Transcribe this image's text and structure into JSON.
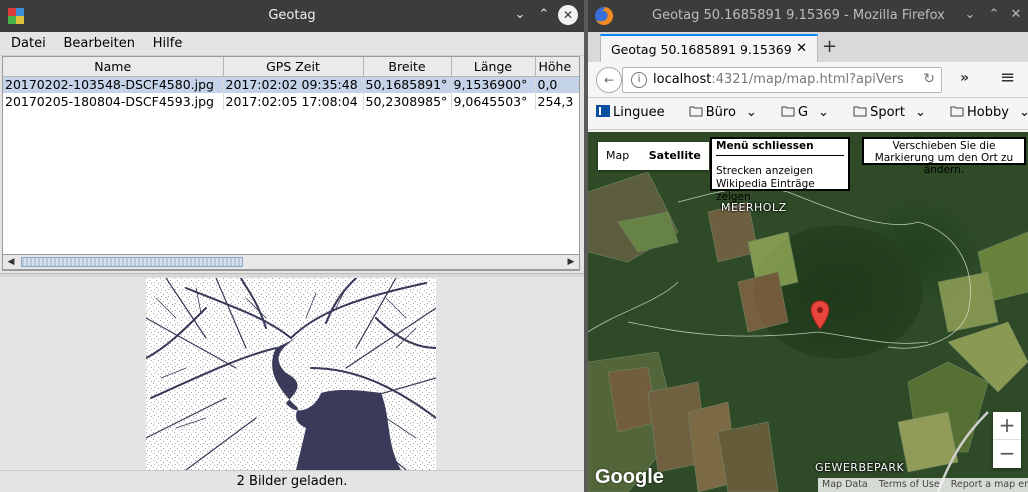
{
  "geotag": {
    "title": "Geotag",
    "menu": [
      "Datei",
      "Bearbeiten",
      "Hilfe"
    ],
    "columns": [
      "Name",
      "GPS Zeit",
      "Breite",
      "Länge",
      "Höhe"
    ],
    "rows": [
      [
        "20170202-103548-DSCF4580.jpg",
        "2017:02:02 09:35:48",
        "50,1685891°",
        "9,1536900°",
        "0,0"
      ],
      [
        "20170205-180804-DSCF4593.jpg",
        "2017:02:05 17:08:04",
        "50,2308985°",
        "9,0645503°",
        "254,3"
      ]
    ],
    "selected_row": 0,
    "status": "2 Bilder geladen."
  },
  "firefox": {
    "window_title": "Geotag 50.1685891 9.15369 - Mozilla Firefox",
    "tab_title": "Geotag 50.1685891 9.15369",
    "url_host": "localhost",
    "url_rest": ":4321/map/map.html?apiVers",
    "bookmarks": [
      "Linguee",
      "Büro",
      "G",
      "Sport",
      "Hobby"
    ]
  },
  "map": {
    "type_buttons": [
      "Map",
      "Satellite"
    ],
    "active_type": "Satellite",
    "menu_title": "Menü schliessen",
    "menu_items": [
      "Strecken anzeigen",
      "Wikipedia Einträge zeigen"
    ],
    "hint": "Verschieben Sie die Markierung um den Ort zu ändern.",
    "labels": [
      "MEERHOLZ",
      "GEWERBEPARK"
    ],
    "logo": "Google",
    "attribution": [
      "Map Data",
      "Terms of Use",
      "Report a map error"
    ],
    "zoom_in": "+",
    "zoom_out": "−"
  },
  "colors": {
    "selection": "#c5d3e8",
    "titlebar": "#3c3c3c",
    "tab_accent": "#0a84ff",
    "pin": "#e8453c"
  }
}
